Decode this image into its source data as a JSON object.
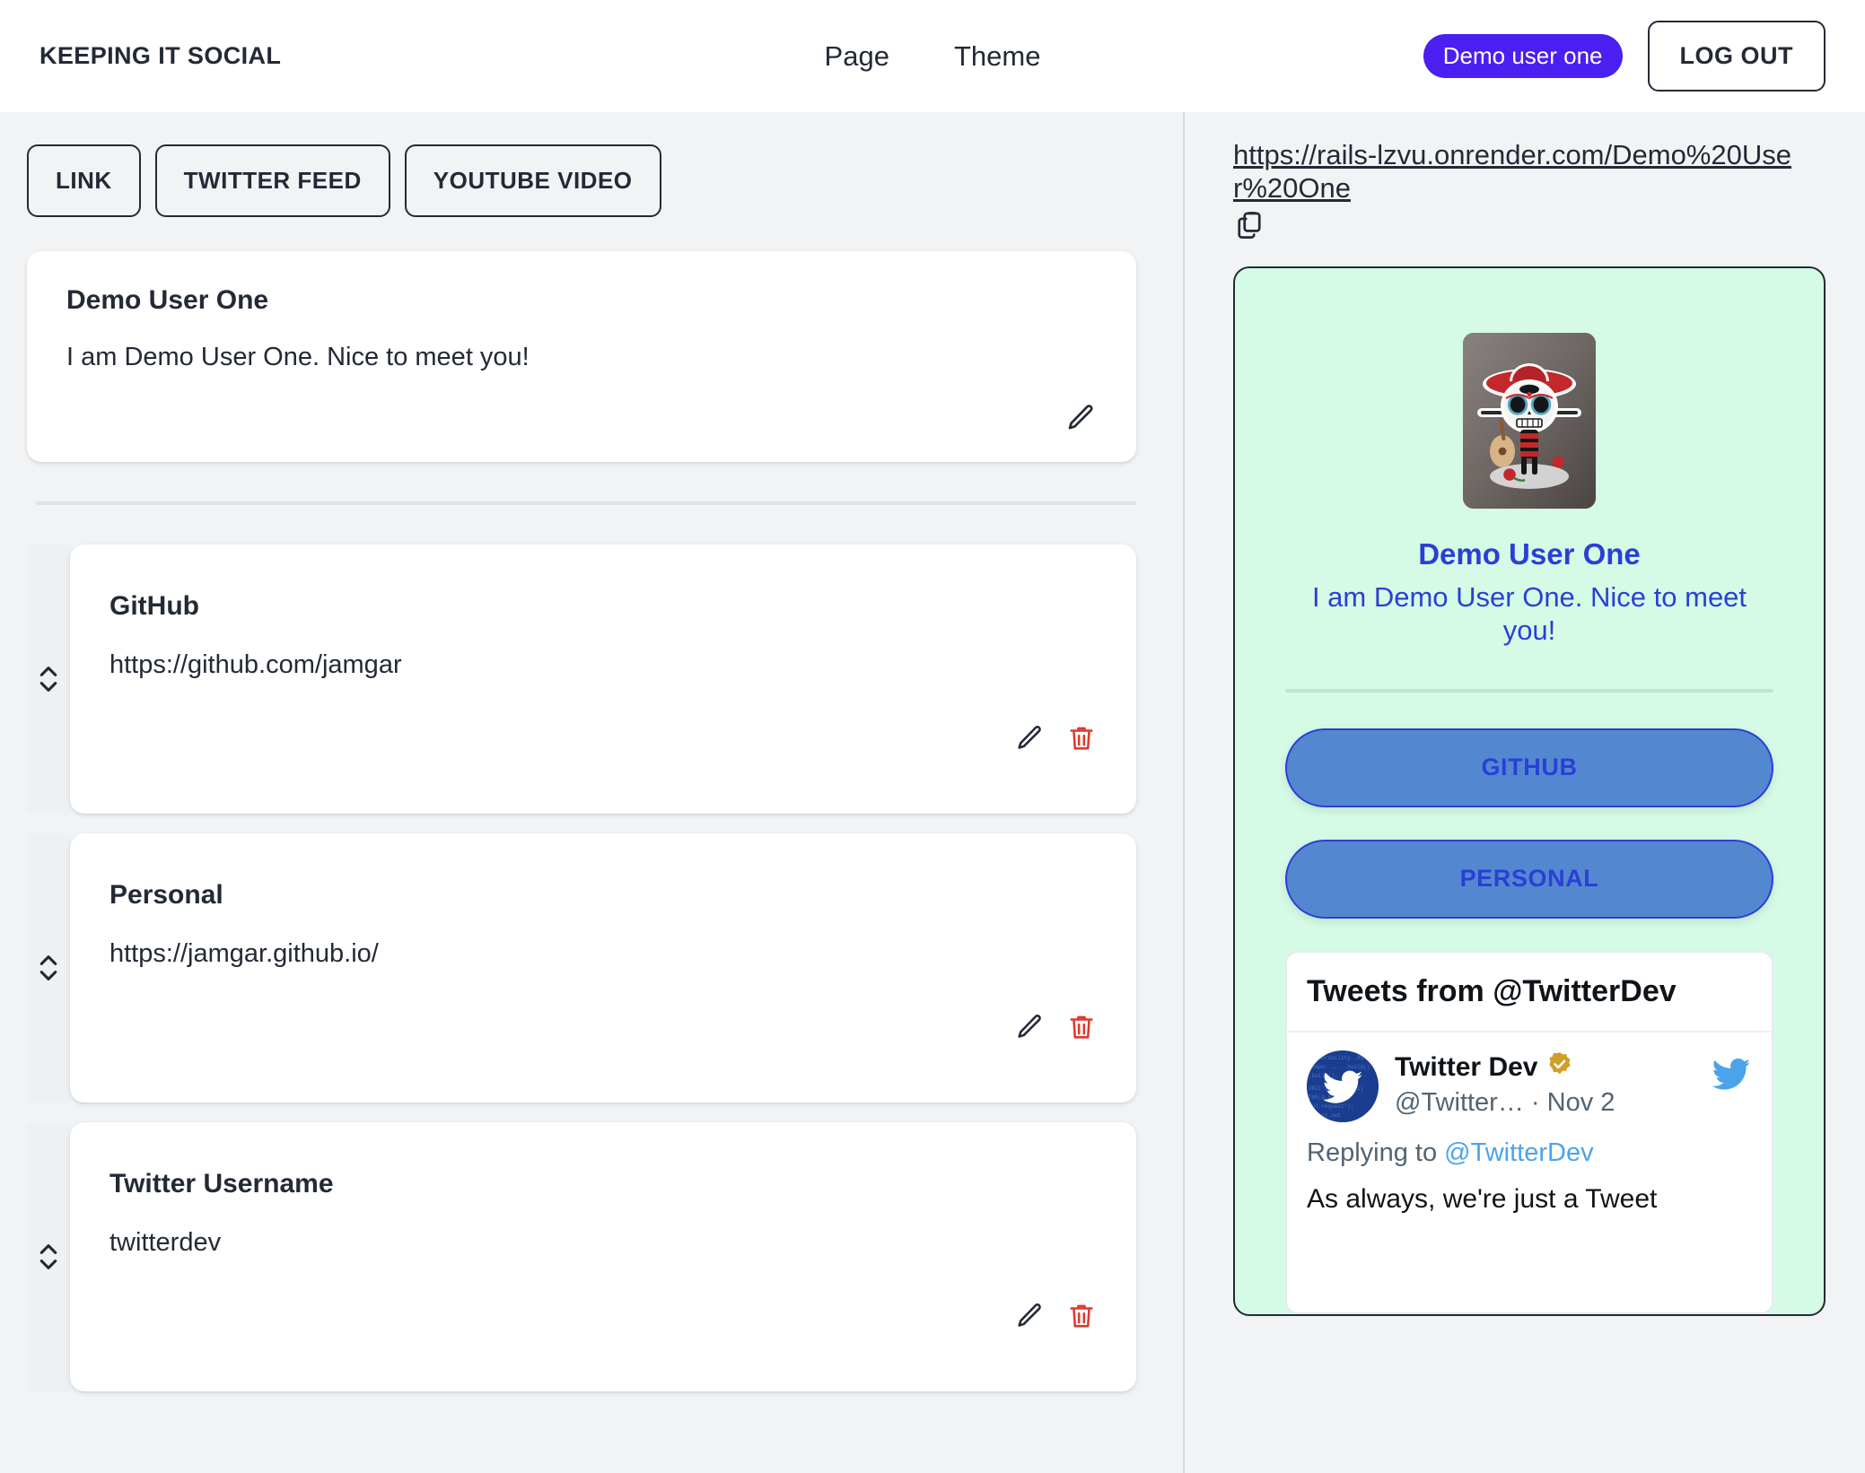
{
  "header": {
    "brand": "KEEPING IT SOCIAL",
    "nav": [
      {
        "label": "Page"
      },
      {
        "label": "Theme"
      }
    ],
    "user_badge": "Demo user one",
    "logout_label": "LOG OUT"
  },
  "toolbar": {
    "buttons": [
      {
        "label": "LINK"
      },
      {
        "label": "TWITTER FEED"
      },
      {
        "label": "YOUTUBE VIDEO"
      }
    ]
  },
  "profile": {
    "name": "Demo User One",
    "bio": "I am Demo User One. Nice to meet you!",
    "edit_icon": "pencil-icon"
  },
  "links": [
    {
      "title": "GitHub",
      "url": "https://github.com/jamgar",
      "drag_icon": "sort-updown-icon",
      "edit_icon": "pencil-icon",
      "delete_icon": "trash-icon"
    },
    {
      "title": "Personal",
      "url": "https://jamgar.github.io/",
      "drag_icon": "sort-updown-icon",
      "edit_icon": "pencil-icon",
      "delete_icon": "trash-icon"
    },
    {
      "title": "Twitter Username",
      "url": "twitterdev",
      "drag_icon": "sort-updown-icon",
      "edit_icon": "pencil-icon",
      "delete_icon": "trash-icon"
    }
  ],
  "share": {
    "url": "https://rails-lzvu.onrender.com/Demo%20User%20One",
    "copy_icon": "copy-icon"
  },
  "preview": {
    "avatar_alt": "sugar-skull-mariachi-sticker",
    "name": "Demo User One",
    "bio": "I am Demo User One. Nice to meet you!",
    "buttons": [
      {
        "label": "GITHUB"
      },
      {
        "label": "PERSONAL"
      }
    ],
    "twitter": {
      "heading": "Tweets from @TwitterDev",
      "account_name": "Twitter Dev",
      "verified_icon": "verified-badge-icon",
      "handle": "@Twitter…",
      "separator": "·",
      "date": "Nov 2",
      "bird_icon": "twitter-bird-icon",
      "replying_prefix": "Replying to",
      "replying_mention": "@TwitterDev",
      "tweet_text": "As always, we're just a Tweet"
    }
  },
  "colors": {
    "accent_purple": "#4a1ff0",
    "preview_bg": "#d5fbe6",
    "preview_text_blue": "#2b3fd6",
    "preview_button_blue": "#5388d0",
    "danger_red": "#e0392b",
    "ink": "#232a35",
    "page_bg": "#f1f3f5"
  }
}
